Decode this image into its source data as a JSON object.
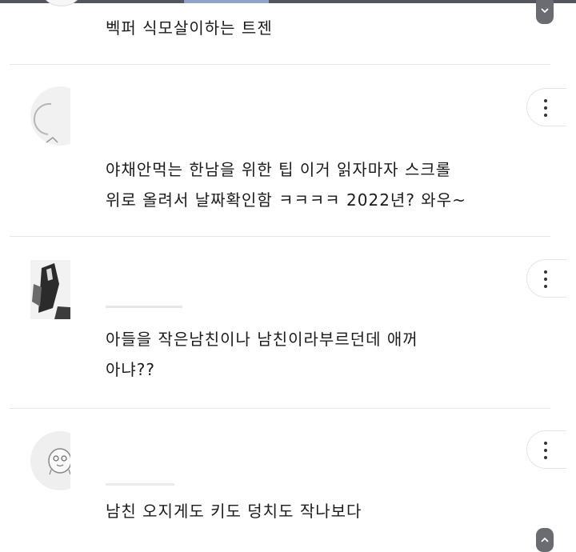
{
  "comments": [
    {
      "text_lines": [
        "벡퍼 식모살이하는 트젠"
      ]
    },
    {
      "text_lines": [
        "야채안먹는 한남을 위한 팁 이거 읽자마자 스크롤",
        "위로 올려서 날짜확인함 ㅋㅋㅋㅋ 2022년? 와우~"
      ]
    },
    {
      "text_lines": [
        "아들을 작은남친이나 남친이라부르던데 애꺼",
        "아냐??"
      ]
    },
    {
      "text_lines": [
        "남친 오지게도 키도 덩치도 작나보다"
      ]
    }
  ],
  "icons": {
    "more": "more-vertical-icon",
    "scroll_down": "chevron-down-icon",
    "scroll_up": "chevron-up-icon"
  },
  "colors": {
    "divider": "#e6e6e6",
    "scroll_button": "#6b6b72",
    "text": "#1b1b1b"
  }
}
